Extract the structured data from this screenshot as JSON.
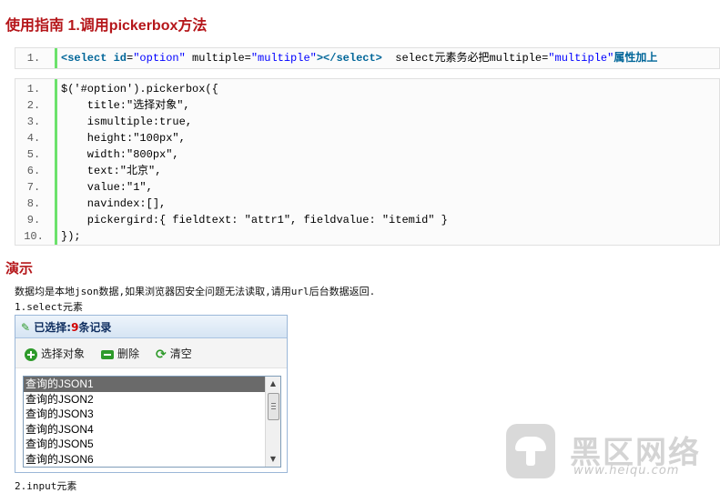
{
  "heading": "使用指南 1.调用pickerbox方法",
  "snippet1": {
    "lines": [
      {
        "num": "1.",
        "parts": [
          {
            "t": "<select ",
            "c": "kw"
          },
          {
            "t": "id",
            "c": "kw"
          },
          {
            "t": "=",
            "c": ""
          },
          {
            "t": "\"option\"",
            "c": "str"
          },
          {
            "t": " multiple=",
            "c": ""
          },
          {
            "t": "\"multiple\"",
            "c": "str"
          },
          {
            "t": "></select>",
            "c": "kw"
          },
          {
            "t": "  select元素务必把multiple=",
            "c": ""
          },
          {
            "t": "\"multiple\"",
            "c": "str"
          },
          {
            "t": "属性加上",
            "c": "kw"
          }
        ]
      }
    ]
  },
  "snippet2": {
    "lines": [
      {
        "num": "1.",
        "text": "$('#option').pickerbox({"
      },
      {
        "num": "2.",
        "text": "    title:\"选择对象\","
      },
      {
        "num": "3.",
        "text": "    ismultiple:true,"
      },
      {
        "num": "4.",
        "text": "    height:\"100px\","
      },
      {
        "num": "5.",
        "text": "    width:\"800px\","
      },
      {
        "num": "6.",
        "text": "    text:\"北京\","
      },
      {
        "num": "7.",
        "text": "    value:\"1\","
      },
      {
        "num": "8.",
        "text": "    navindex:[],"
      },
      {
        "num": "9.",
        "text": "    pickergird:{ fieldtext: \"attr1\", fieldvalue: \"itemid\" }"
      },
      {
        "num": "10.",
        "text": "});"
      }
    ]
  },
  "demo": {
    "heading": "演示",
    "description": "数据均是本地json数据,如果浏览器因安全问题无法读取,请用url后台数据返回.",
    "select_label": "1.select元素",
    "input_label": "2.input元素",
    "picker": {
      "title_prefix": "已选择:",
      "count": "9",
      "title_suffix": "条记录",
      "toolbar": {
        "select_label": "选择对象",
        "delete_label": "删除",
        "clear_label": "清空"
      },
      "items": [
        "查询的JSON1",
        "查询的JSON2",
        "查询的JSON3",
        "查询的JSON4",
        "查询的JSON5",
        "查询的JSON6"
      ],
      "selected_index": 0
    }
  },
  "watermark": {
    "name": "黑区网络",
    "url": "www.heiqu.com"
  }
}
